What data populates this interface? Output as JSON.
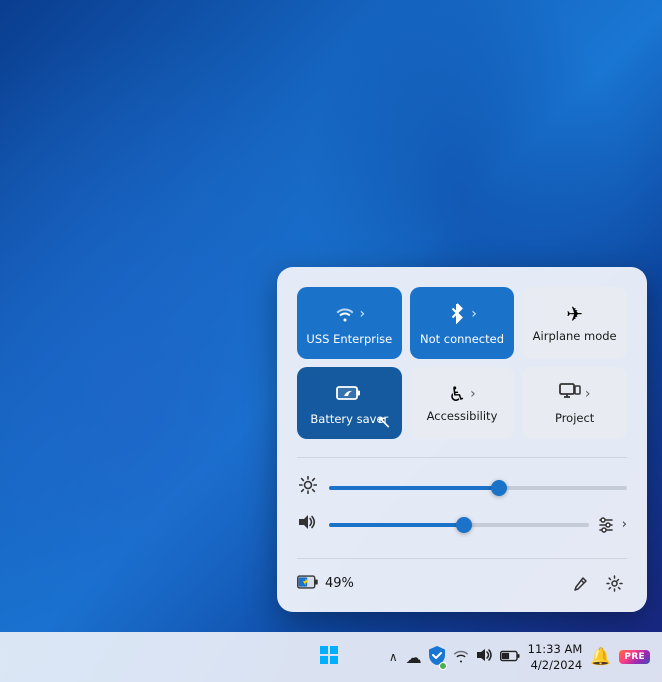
{
  "wallpaper": {
    "alt": "Windows 11 blue wallpaper"
  },
  "quickSettings": {
    "tiles": [
      {
        "id": "wifi",
        "label": "USS Enterprise",
        "icon": "wifi",
        "arrow": true,
        "active": true,
        "activeClass": "active"
      },
      {
        "id": "bluetooth",
        "label": "Not connected",
        "icon": "bluetooth",
        "arrow": true,
        "active": true,
        "activeClass": "active"
      },
      {
        "id": "airplane",
        "label": "Airplane mode",
        "icon": "airplane",
        "arrow": false,
        "active": false,
        "activeClass": ""
      },
      {
        "id": "battery-saver",
        "label": "Battery saver",
        "icon": "battery-saver",
        "arrow": false,
        "active": true,
        "activeClass": "active-darker"
      },
      {
        "id": "accessibility",
        "label": "Accessibility",
        "icon": "accessibility",
        "arrow": true,
        "active": false,
        "activeClass": ""
      },
      {
        "id": "project",
        "label": "Project",
        "icon": "project",
        "arrow": true,
        "active": false,
        "activeClass": ""
      }
    ],
    "brightness": {
      "value": 57,
      "icon": "brightness"
    },
    "volume": {
      "value": 52,
      "icon": "volume",
      "endIcon": "volume-settings"
    },
    "battery": {
      "percent": "49%",
      "icon": "battery-charging"
    },
    "footer": {
      "editLabel": "✏",
      "settingsLabel": "⚙"
    }
  },
  "taskbar": {
    "chevronLabel": "∧",
    "icons": [
      {
        "id": "cloud",
        "symbol": "☁"
      },
      {
        "id": "defender",
        "symbol": "🛡"
      },
      {
        "id": "wifi",
        "symbol": "📶"
      },
      {
        "id": "volume",
        "symbol": "🔊"
      },
      {
        "id": "battery",
        "symbol": "🔋"
      }
    ],
    "clock": {
      "time": "11:33 AM",
      "date": "4/2/2024"
    },
    "bell": "🔔",
    "preBadge": "PRE"
  }
}
